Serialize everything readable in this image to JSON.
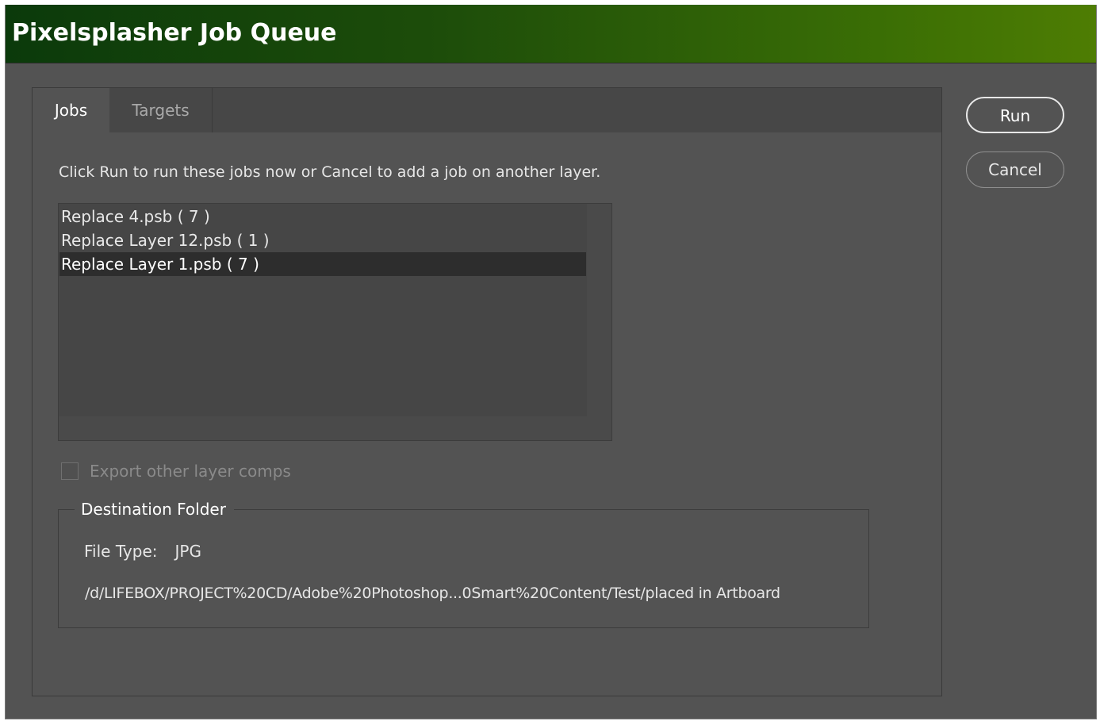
{
  "window": {
    "title": "Pixelsplasher Job Queue"
  },
  "tabs": [
    {
      "label": "Jobs",
      "active": true
    },
    {
      "label": "Targets",
      "active": false
    }
  ],
  "jobs_tab": {
    "instruction": "Click Run to run these jobs now or Cancel to add a job on another layer.",
    "jobs": [
      {
        "label": "Replace 4.psb ( 7 )",
        "selected": false
      },
      {
        "label": "Replace Layer 12.psb ( 1 )",
        "selected": false
      },
      {
        "label": "Replace Layer 1.psb ( 7 )",
        "selected": true
      }
    ],
    "export_comps": {
      "label": "Export other layer comps",
      "checked": false,
      "enabled": false
    },
    "destination": {
      "legend": "Destination Folder",
      "file_type_label": "File Type:",
      "file_type_value": "JPG",
      "path": "/d/LIFEBOX/PROJECT%20CD/Adobe%20Photoshop...0Smart%20Content/Test/placed in Artboard"
    }
  },
  "buttons": {
    "run_label": "Run",
    "cancel_label": "Cancel"
  },
  "colors": {
    "title_gradient_start": "#0b3a0b",
    "title_gradient_end": "#4e7d03",
    "background": "#535353",
    "selected_row": "#2d2d2d"
  }
}
